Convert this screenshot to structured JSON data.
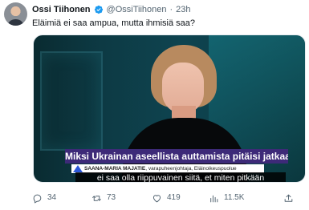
{
  "tweet": {
    "author": {
      "display_name": "Ossi Tiihonen",
      "handle": "@OssiTiihonen",
      "time": "23h",
      "verified": true,
      "avatar_icon": "user-avatar"
    },
    "separator": "·",
    "text": "Eläimiä ei saa ampua, mutta ihmisiä saa?"
  },
  "media": {
    "kind": "video-still",
    "question_banner": "Miksi Ukrainan aseellista auttamista pitäisi jatkaa?",
    "speaker_name": "SAANA-MARIA MAJATIE",
    "speaker_role": ", varapuheenjohtaja, Eläinoikeuspuolue",
    "subtitle": "ei saa olla riippuvainen siitä, et miten pitkään",
    "colors": {
      "banner": "#3d2a78",
      "subtitle_bg": "#000000"
    }
  },
  "actions": {
    "reply": {
      "icon": "reply-icon",
      "count": "34"
    },
    "retweet": {
      "icon": "retweet-icon",
      "count": "73"
    },
    "like": {
      "icon": "heart-icon",
      "count": "419"
    },
    "views": {
      "icon": "views-icon",
      "count": "11.5K"
    },
    "share": {
      "icon": "share-icon"
    }
  },
  "colors": {
    "text_primary": "#0f1419",
    "text_secondary": "#536471",
    "verified": "#1d9bf0"
  }
}
